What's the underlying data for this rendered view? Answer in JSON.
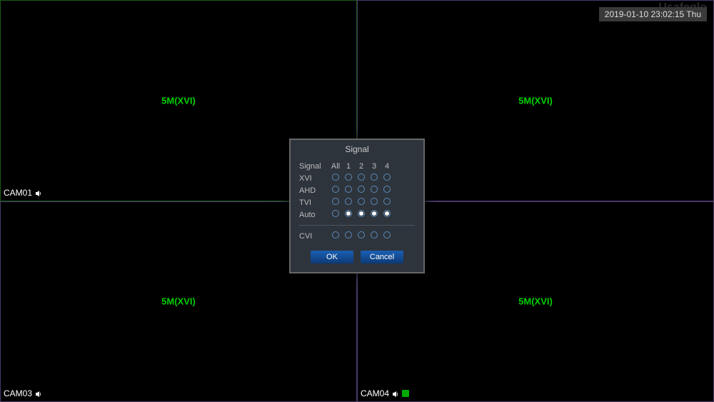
{
  "timestamp": "2019-01-10 23:02:15 Thu",
  "watermark": "Usafeglo",
  "quads": [
    {
      "cam": "CAM01",
      "res": "5M(XVI)",
      "border": "green",
      "icons": [
        "speaker"
      ]
    },
    {
      "cam": "",
      "res": "5M(XVI)",
      "border": "purple",
      "icons": []
    },
    {
      "cam": "CAM03",
      "res": "5M(XVI)",
      "border": "purple",
      "icons": [
        "speaker"
      ]
    },
    {
      "cam": "CAM04",
      "res": "5M(XVI)",
      "border": "purple",
      "icons": [
        "speaker",
        "rec"
      ]
    }
  ],
  "dialog": {
    "title": "Signal",
    "header": {
      "label": "Signal",
      "cols": [
        "All",
        "1",
        "2",
        "3",
        "4"
      ]
    },
    "rows": [
      {
        "label": "XVI",
        "selected": [
          false,
          false,
          false,
          false,
          false
        ]
      },
      {
        "label": "AHD",
        "selected": [
          false,
          false,
          false,
          false,
          false
        ]
      },
      {
        "label": "TVI",
        "selected": [
          false,
          false,
          false,
          false,
          false
        ]
      },
      {
        "label": "Auto",
        "selected": [
          false,
          true,
          true,
          true,
          true
        ]
      }
    ],
    "rows2": [
      {
        "label": "CVI",
        "selected": [
          false,
          false,
          false,
          false,
          false
        ]
      }
    ],
    "ok": "OK",
    "cancel": "Cancel"
  }
}
